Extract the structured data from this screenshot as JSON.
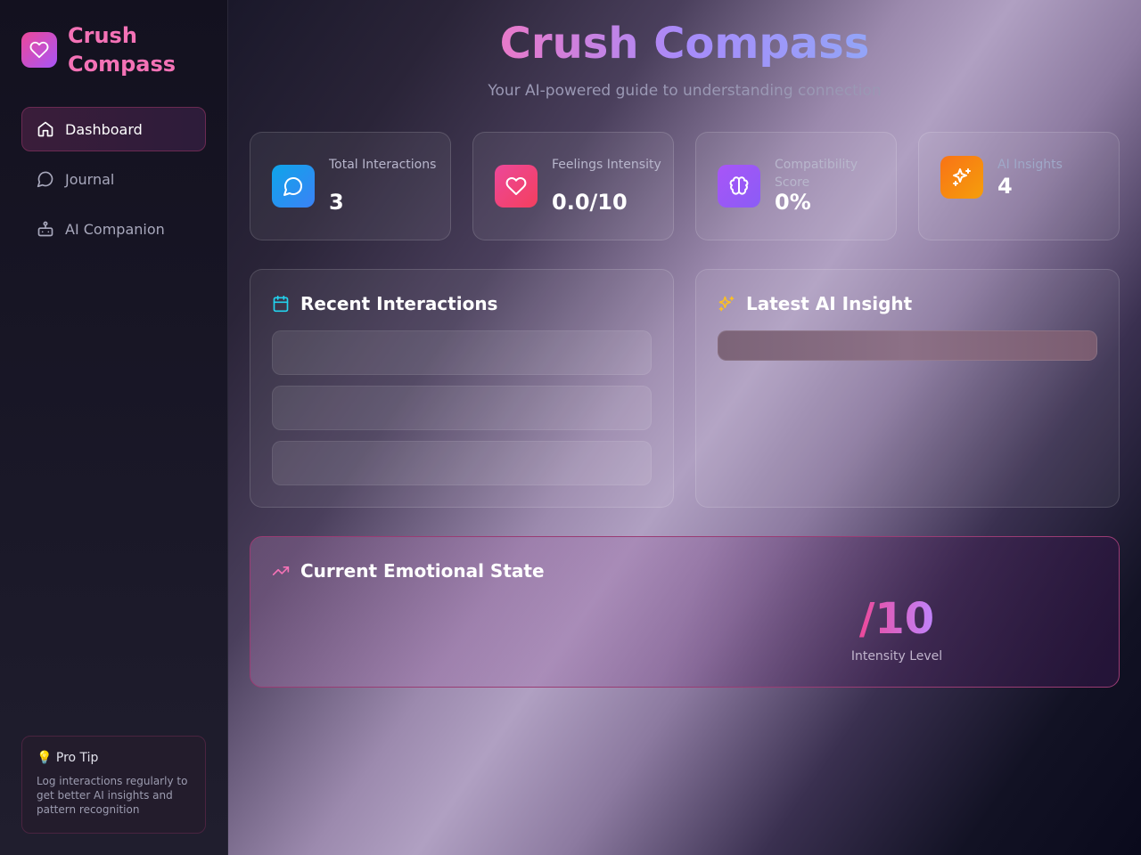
{
  "brand": {
    "name": "Crush Compass",
    "logo_icon": "heart-icon",
    "accent": "#ec4899"
  },
  "sidebar": {
    "items": [
      {
        "label": "Dashboard",
        "icon": "home-icon",
        "active": true
      },
      {
        "label": "Journal",
        "icon": "message-circle-icon",
        "active": false
      },
      {
        "label": "AI Companion",
        "icon": "bot-icon",
        "active": false
      }
    ],
    "protip": {
      "title": "💡 Pro Tip",
      "text": "Log interactions regularly to get better AI insights and pattern recognition"
    }
  },
  "header": {
    "title": "Crush Compass",
    "subtitle": "Your AI-powered guide to understanding connection"
  },
  "stats": [
    {
      "label": "Total Interactions",
      "value": "3",
      "icon": "message-circle-icon",
      "color": "#0ea5e9"
    },
    {
      "label": "Feelings Intensity",
      "value": "0.0/10",
      "icon": "heart-icon",
      "color": "#ec4899"
    },
    {
      "label": "Compatibility Score",
      "value": "0%",
      "icon": "brain-icon",
      "color": "#a855f7"
    },
    {
      "label": "AI Insights",
      "value": "4",
      "icon": "sparkles-icon",
      "color": "#f97316"
    }
  ],
  "recent": {
    "title": "Recent Interactions",
    "icon": "calendar-icon"
  },
  "insight": {
    "title": "Latest AI Insight",
    "icon": "sparkles-icon"
  },
  "emotional": {
    "title": "Current Emotional State",
    "icon": "trending-up-icon",
    "value": "/10",
    "label": "Intensity Level"
  }
}
